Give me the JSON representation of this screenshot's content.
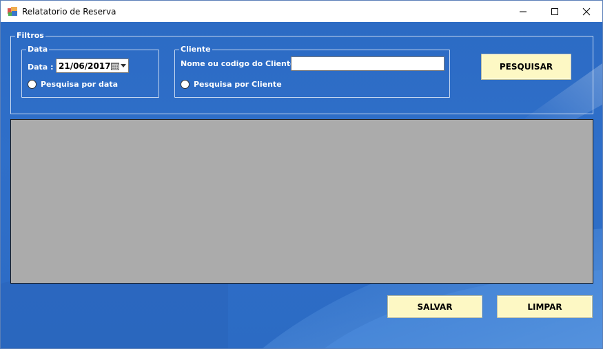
{
  "window": {
    "title": "Relatatorio de Reserva"
  },
  "filters": {
    "legend": "Filtros",
    "data_group": {
      "legend": "Data",
      "date_label": "Data :",
      "date_value": "21/06/2017",
      "radio_label": "Pesquisa por data"
    },
    "cliente_group": {
      "legend": "Cliente",
      "name_label": "Nome ou codigo do Cliente:",
      "name_value": "",
      "radio_label": "Pesquisa por Cliente"
    },
    "search_button": "PESQUISAR"
  },
  "actions": {
    "save_button": "SALVAR",
    "clear_button": "LIMPAR"
  },
  "colors": {
    "background": "#2c6bc4",
    "button_fill": "#fdf8c4",
    "grid_fill": "#ababab"
  }
}
